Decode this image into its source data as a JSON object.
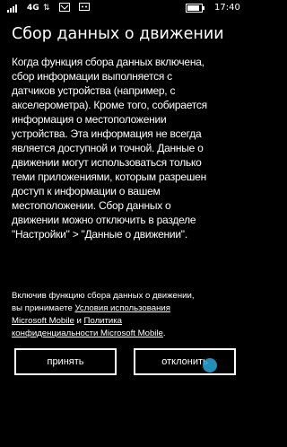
{
  "status_bar": {
    "network": "4G",
    "time": "17:40",
    "icons": [
      "signal-icon",
      "data-arrows-icon",
      "wifi-icon",
      "message-icon",
      "battery-icon"
    ]
  },
  "title": "Сбор данных о движении",
  "body_lines": [
    "Когда функция сбора данных включена,",
    "сбор информации выполняется с",
    "датчиков устройства (например, с",
    "акселерометра). Кроме того, собирается",
    "информация о местоположении",
    "устройства. Эта информация не всегда",
    "является доступной и точной. Данные о",
    "движении могут использоваться только",
    "теми приложениями, которым разрешен",
    "доступ к информации о вашем",
    "местоположении. Сбор данных о",
    "движении можно отключить в разделе",
    "\"Настройки\" > \"Данные о движении\"."
  ],
  "consent": {
    "line1": "Включив функцию сбора данных о движении,",
    "line2_prefix": "вы принимаете ",
    "terms_link_part1": "Условия использования",
    "terms_link_part2": "Microsoft Mobile",
    "conjunction": " и ",
    "privacy_link_part1": "Политика",
    "privacy_link_part2": "конфиденциальности Microsoft Mobile",
    "suffix": "."
  },
  "buttons": {
    "accept": "принять",
    "decline": "отклонить"
  },
  "colors": {
    "background": "#000000",
    "text": "#ffffff"
  }
}
